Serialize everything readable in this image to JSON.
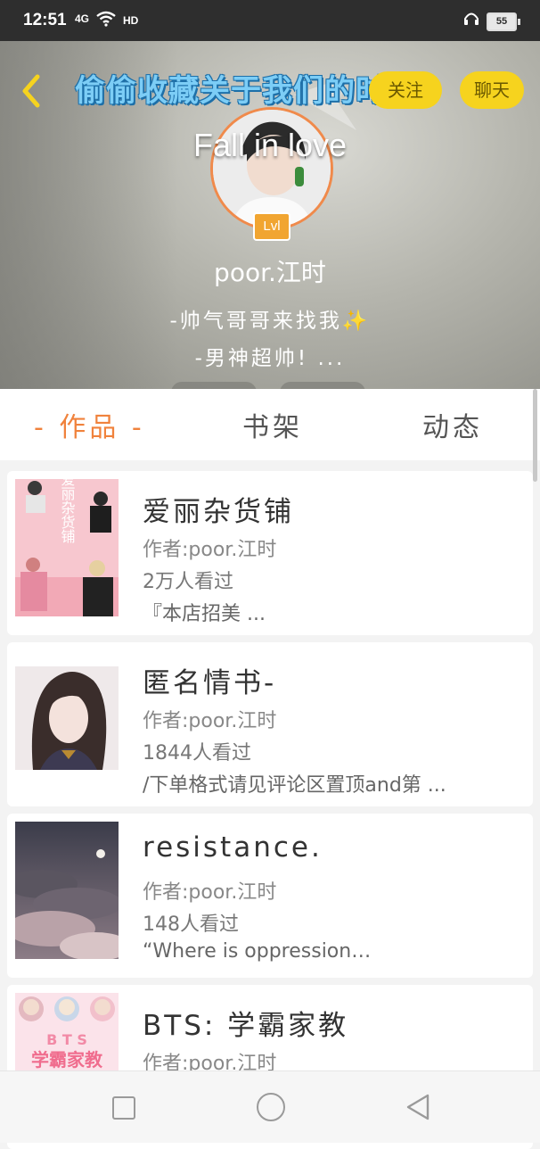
{
  "status_bar": {
    "time": "12:51",
    "signal": "4G",
    "hd": "HD",
    "battery": "55"
  },
  "header": {
    "banner_title": "偷偷收藏关于我们的时间",
    "follow_label": "关注",
    "chat_label": "聊天",
    "overlay_text": "Fall in love",
    "level": "Lvl",
    "username": "poor.江时",
    "bio_line1": "-帅气哥哥来找我",
    "bio_line1_emoji": "✨",
    "bio_line2": "-男神超帅! ..."
  },
  "tabs": [
    {
      "label": "- 作品 -",
      "active": true
    },
    {
      "label": "书架",
      "active": false
    },
    {
      "label": "动态",
      "active": false
    }
  ],
  "works": [
    {
      "title": "爱丽杂货铺",
      "author": "作者:poor.江时",
      "views": "2万人看过",
      "desc": "『本店招美 ..."
    },
    {
      "title": "匿名情书-",
      "author": "作者:poor.江时",
      "views": "1844人看过",
      "desc": "/下单格式请见评论区置顶and第 ..."
    },
    {
      "title": "resistance.",
      "author": "作者:poor.江时",
      "views": "148人看过",
      "desc": "“Where is oppression…"
    },
    {
      "title": "BTS: 学霸家教",
      "author": "作者:poor.江时",
      "views": "",
      "desc": ""
    }
  ],
  "cover_texts": {
    "cover1": "爱丽杂货铺",
    "cover4_line1": "B T S",
    "cover4_line2": "学霸家教"
  },
  "colors": {
    "accent": "#f0823c",
    "pill": "#f6d31e",
    "banner": "#7ccdf6"
  }
}
